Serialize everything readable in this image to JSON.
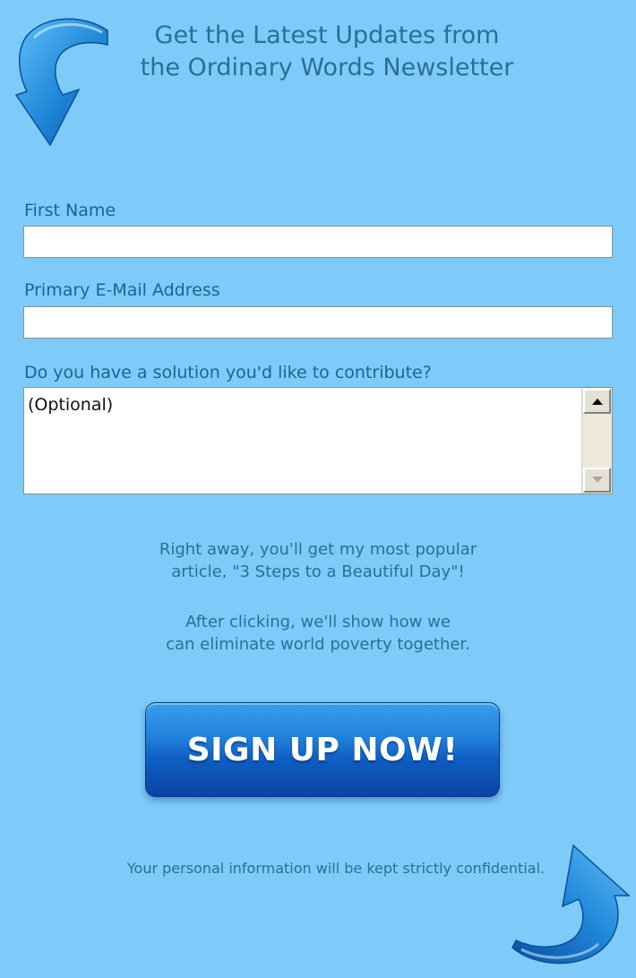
{
  "newsletter": {
    "headline_line1": "Get the Latest Updates from",
    "headline_line2": "the Ordinary Words Newsletter"
  },
  "form": {
    "first_name_label": "First Name",
    "first_name_value": "",
    "email_label": "Primary E-Mail Address",
    "email_value": "",
    "solution_label": "Do you have a solution you'd like to contribute?",
    "solution_value": "(Optional)"
  },
  "blurb": {
    "line1": "Right away, you'll get my most popular",
    "line2": "article, \"3 Steps to a Beautiful Day\"!",
    "line3": "After clicking, we'll show how we",
    "line4": "can eliminate world poverty together."
  },
  "cta": {
    "label": "SIGN UP NOW!"
  },
  "footer": {
    "privacy_note": "Your personal information will be kept strictly confidential."
  },
  "icons": {
    "top": "curved-arrow-down-icon",
    "bottom": "curved-arrow-up-icon",
    "scroll_up": "scroll-up-arrow-icon",
    "scroll_down": "scroll-down-arrow-icon"
  },
  "colors": {
    "background": "#7ecbf9",
    "text": "#2a6f96",
    "button_top": "#3a9fea",
    "button_bottom": "#0b43a6",
    "arrow": "#1678c8"
  }
}
